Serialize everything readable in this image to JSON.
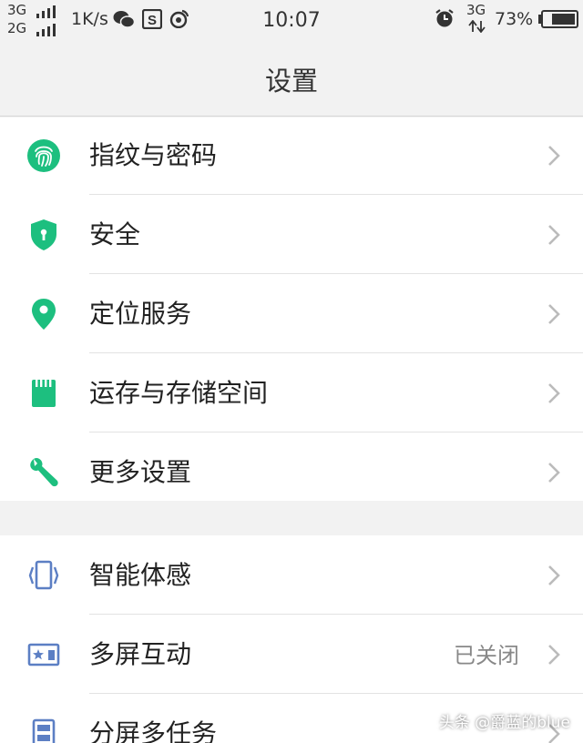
{
  "status_bar": {
    "signal_1": "3G",
    "signal_2": "2G",
    "net_speed": "1K/s",
    "time": "10:07",
    "network": "3G",
    "battery": "73%"
  },
  "header": {
    "title": "设置"
  },
  "groups": [
    {
      "items": [
        {
          "label": "指纹与密码",
          "icon": "fingerprint-icon"
        },
        {
          "label": "安全",
          "icon": "shield-icon"
        },
        {
          "label": "定位服务",
          "icon": "location-pin-icon"
        },
        {
          "label": "运存与存储空间",
          "icon": "sd-card-icon"
        },
        {
          "label": "更多设置",
          "icon": "wrench-icon"
        }
      ]
    },
    {
      "items": [
        {
          "label": "智能体感",
          "icon": "phone-shake-icon"
        },
        {
          "label": "多屏互动",
          "icon": "screen-cast-icon",
          "value": "已关闭"
        },
        {
          "label": "分屏多任务",
          "icon": "split-screen-icon"
        }
      ]
    }
  ],
  "watermark": "头条 @爵蓝的blue",
  "colors": {
    "green": "#1dbf7f",
    "blue": "#5c7fc4",
    "background": "#f2f2f2",
    "chevron": "#bbbbbb"
  }
}
